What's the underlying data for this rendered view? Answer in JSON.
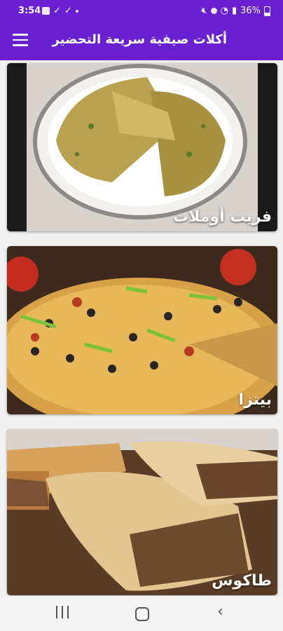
{
  "status_bar": {
    "time": "3:54",
    "battery": "36%",
    "left_icons": [
      "image-icon",
      "check-icon",
      "check-icon",
      "dot-icon"
    ],
    "right_icons": [
      "mute-icon",
      "wifi-calling-icon",
      "wifi-icon",
      "signal-icon",
      "battery-icon"
    ]
  },
  "app_bar": {
    "title": "أكلات صيفية سريعة التحضير",
    "menu_icon": "hamburger-menu-icon"
  },
  "cards": [
    {
      "label": "فريت أوملات"
    },
    {
      "label": "بيتزا"
    },
    {
      "label": "طاكوس"
    }
  ],
  "nav_bar": {
    "buttons": [
      "recents-icon",
      "home-icon",
      "back-icon"
    ]
  },
  "colors": {
    "primary": "#6a1fd0",
    "background": "#f1f1f1"
  }
}
